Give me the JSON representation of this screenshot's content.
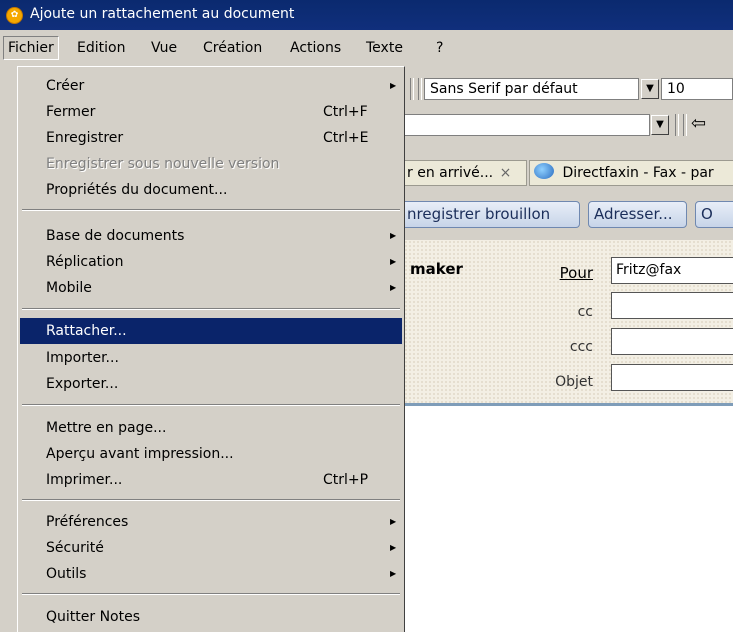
{
  "window": {
    "title": "Ajoute un rattachement au document",
    "app_icon": "lotus-notes-icon",
    "accent": "#0a246a"
  },
  "menubar": {
    "items": [
      "Fichier",
      "Edition",
      "Vue",
      "Création",
      "Actions",
      "Texte",
      "?"
    ],
    "active": "Fichier"
  },
  "toolbar": {
    "font_name": "Sans Serif par défaut",
    "font_size": "10",
    "back_icon": "back-arrow-icon"
  },
  "tabs": [
    {
      "label": "r en arrivé...",
      "close": "×"
    },
    {
      "label": "Directfaxin - Fax - par",
      "icon": "directfax-icon"
    }
  ],
  "actions": {
    "save_draft": "nregistrer brouillon",
    "address": "Adresser...",
    "more": "O"
  },
  "memo": {
    "sender": "maker",
    "to_label": "Pour",
    "to_value": "Fritz@fax",
    "cc_label": "cc",
    "cc_value": "",
    "bcc_label": "ccc",
    "bcc_value": "",
    "subject_label": "Objet",
    "subject_value": ""
  },
  "file_menu": {
    "items": [
      {
        "label": "Créer",
        "submenu": true
      },
      {
        "label": "Fermer",
        "shortcut": "Ctrl+F"
      },
      {
        "label": "Enregistrer",
        "shortcut": "Ctrl+E"
      },
      {
        "label": "Enregistrer sous nouvelle version",
        "disabled": true
      },
      {
        "label": "Propriétés du document..."
      },
      {
        "label": "Base de documents",
        "submenu": true
      },
      {
        "label": "Réplication",
        "submenu": true
      },
      {
        "label": "Mobile",
        "submenu": true
      },
      {
        "label": "Rattacher...",
        "selected": true
      },
      {
        "label": "Importer..."
      },
      {
        "label": "Exporter..."
      },
      {
        "label": "Mettre en page..."
      },
      {
        "label": "Aperçu avant impression..."
      },
      {
        "label": "Imprimer...",
        "shortcut": "Ctrl+P"
      },
      {
        "label": "Préférences",
        "submenu": true
      },
      {
        "label": "Sécurité",
        "submenu": true
      },
      {
        "label": "Outils",
        "submenu": true
      },
      {
        "label": "Quitter Notes"
      }
    ]
  }
}
